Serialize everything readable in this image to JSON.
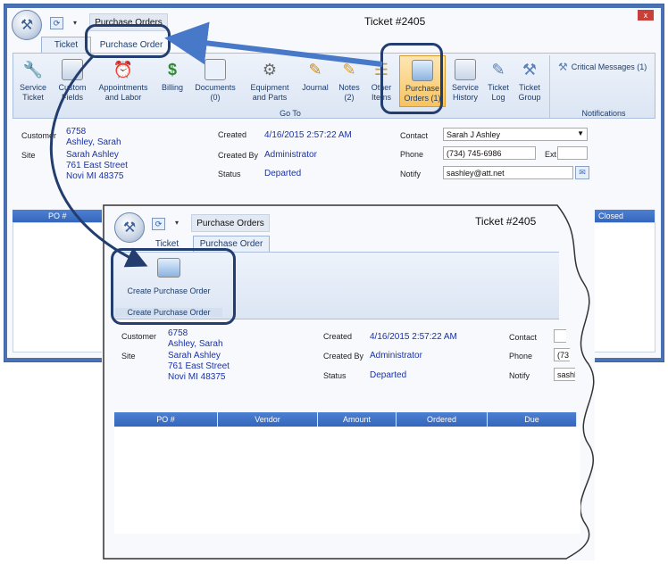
{
  "window1": {
    "app_tab": "Purchase Orders",
    "title": "Ticket #2405",
    "close_glyph": "x",
    "tabs": [
      {
        "label": "Ticket"
      },
      {
        "label": "Purchase Order"
      }
    ],
    "ribbon": {
      "buttons": [
        {
          "label": "Service Ticket",
          "icon": "wrench-icon"
        },
        {
          "label": "Custom Fields",
          "icon": "custom-fields-icon"
        },
        {
          "label": "Appointments and Labor",
          "icon": "clock-icon"
        },
        {
          "label": "Billing",
          "icon": "dollar-icon"
        },
        {
          "label": "Documents (0)",
          "icon": "document-icon"
        },
        {
          "label": "Equipment and Parts",
          "icon": "equipment-icon"
        },
        {
          "label": "Journal",
          "icon": "journal-icon"
        },
        {
          "label": "Notes (2)",
          "icon": "notes-icon"
        },
        {
          "label": "Other Items",
          "icon": "other-items-icon"
        },
        {
          "label": "Purchase Orders (1)",
          "icon": "purchase-orders-icon"
        },
        {
          "label": "Service History",
          "icon": "history-icon"
        },
        {
          "label": "Ticket Log",
          "icon": "ticket-log-icon"
        },
        {
          "label": "Ticket Group",
          "icon": "ticket-group-icon"
        }
      ],
      "goto_label": "Go To",
      "notifications": {
        "critical": "Critical Messages (1)",
        "label": "Notifications"
      }
    },
    "info": {
      "customer_label": "Customer",
      "customer_id": "6758",
      "customer_name": "Ashley, Sarah",
      "site_label": "Site",
      "site_name": "Sarah Ashley",
      "site_street": "761 East Street",
      "site_city": "Novi MI 48375",
      "created_label": "Created",
      "created_value": "4/16/2015 2:57:22 AM",
      "created_by_label": "Created By",
      "created_by_value": "Administrator",
      "status_label": "Status",
      "status_value": "Departed",
      "contact_label": "Contact",
      "contact_value": "Sarah J Ashley",
      "phone_label": "Phone",
      "phone_value": "(734) 745-6986",
      "ext_label": "Ext",
      "notify_label": "Notify",
      "notify_value": "sashley@att.net"
    },
    "grid": {
      "po_header": "PO #",
      "closed_header": "Closed"
    }
  },
  "window2": {
    "app_tab": "Purchase Orders",
    "title": "Ticket #2405",
    "tabs": [
      {
        "label": "Ticket"
      },
      {
        "label": "Purchase Order"
      }
    ],
    "create_po_button": "Create Purchase Order",
    "group_label": "Create Purchase Order",
    "info": {
      "customer_label": "Customer",
      "customer_id": "6758",
      "customer_name": "Ashley, Sarah",
      "site_label": "Site",
      "site_name": "Sarah Ashley",
      "site_street": "761 East Street",
      "site_city": "Novi MI 48375",
      "created_label": "Created",
      "created_value": "4/16/2015 2:57:22 AM",
      "created_by_label": "Created By",
      "created_by_value": "Administrator",
      "status_label": "Status",
      "status_value": "Departed",
      "contact_label": "Contact",
      "phone_label": "Phone",
      "phone_value": "(73",
      "notify_label": "Notify",
      "notify_value": "sashl"
    },
    "grid": {
      "columns": [
        "PO #",
        "Vendor",
        "Amount",
        "Ordered",
        "Due"
      ]
    }
  },
  "colors": {
    "accent": "#3466bd",
    "link_text": "#1a33a8",
    "callout": "#223d6e",
    "window_border": "#4a72b4"
  }
}
